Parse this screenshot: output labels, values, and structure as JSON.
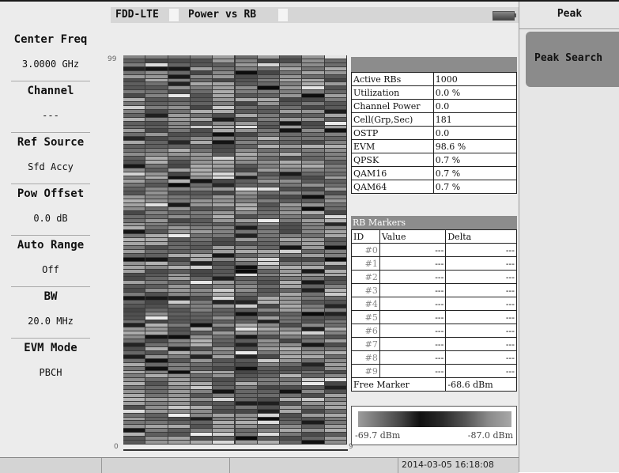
{
  "header": {
    "mode": "FDD-LTE",
    "measurement": "Power vs RB"
  },
  "left_params": [
    {
      "label": "Center Freq",
      "value": "3.0000 GHz"
    },
    {
      "label": "Channel",
      "value": "---"
    },
    {
      "label": "Ref Source",
      "value": "Sfd Accy"
    },
    {
      "label": "Pow Offset",
      "value": "0.0 dB"
    },
    {
      "label": "Auto Range",
      "value": "Off"
    },
    {
      "label": "BW",
      "value": "20.0 MHz"
    },
    {
      "label": "EVM Mode",
      "value": "PBCH"
    }
  ],
  "heatmap": {
    "y_top": "99",
    "y_bottom": "0",
    "x_right": "9"
  },
  "info_table": {
    "rows": [
      {
        "label": "Active RBs",
        "value": "1000"
      },
      {
        "label": "Utilization",
        "value": "0.0 %"
      },
      {
        "label": "Channel Power",
        "value": "0.0"
      },
      {
        "label": "Cell(Grp,Sec)",
        "value": "181"
      },
      {
        "label": "OSTP",
        "value": "0.0"
      },
      {
        "label": "EVM",
        "value": "98.6 %"
      },
      {
        "label": "QPSK",
        "value": "0.7 %"
      },
      {
        "label": "QAM16",
        "value": "0.7 %"
      },
      {
        "label": "QAM64",
        "value": "0.7 %"
      }
    ]
  },
  "rb_markers": {
    "title": "RB Markers",
    "headers": [
      "ID",
      "Value",
      "Delta"
    ],
    "rows": [
      {
        "id": "#0",
        "value": "---",
        "delta": "---"
      },
      {
        "id": "#1",
        "value": "---",
        "delta": "---"
      },
      {
        "id": "#2",
        "value": "---",
        "delta": "---"
      },
      {
        "id": "#3",
        "value": "---",
        "delta": "---"
      },
      {
        "id": "#4",
        "value": "---",
        "delta": "---"
      },
      {
        "id": "#5",
        "value": "---",
        "delta": "---"
      },
      {
        "id": "#6",
        "value": "---",
        "delta": "---"
      },
      {
        "id": "#7",
        "value": "---",
        "delta": "---"
      },
      {
        "id": "#8",
        "value": "---",
        "delta": "---"
      },
      {
        "id": "#9",
        "value": "---",
        "delta": "---"
      }
    ],
    "free_marker_label": "Free Marker",
    "free_marker_value": "-68.6 dBm"
  },
  "scale": {
    "left": "-69.7 dBm",
    "right": "-87.0 dBm"
  },
  "status": {
    "datetime": "2014-03-05 16:18:08"
  },
  "softkeys": {
    "title": "Peak",
    "buttons": [
      "Peak Search"
    ]
  }
}
